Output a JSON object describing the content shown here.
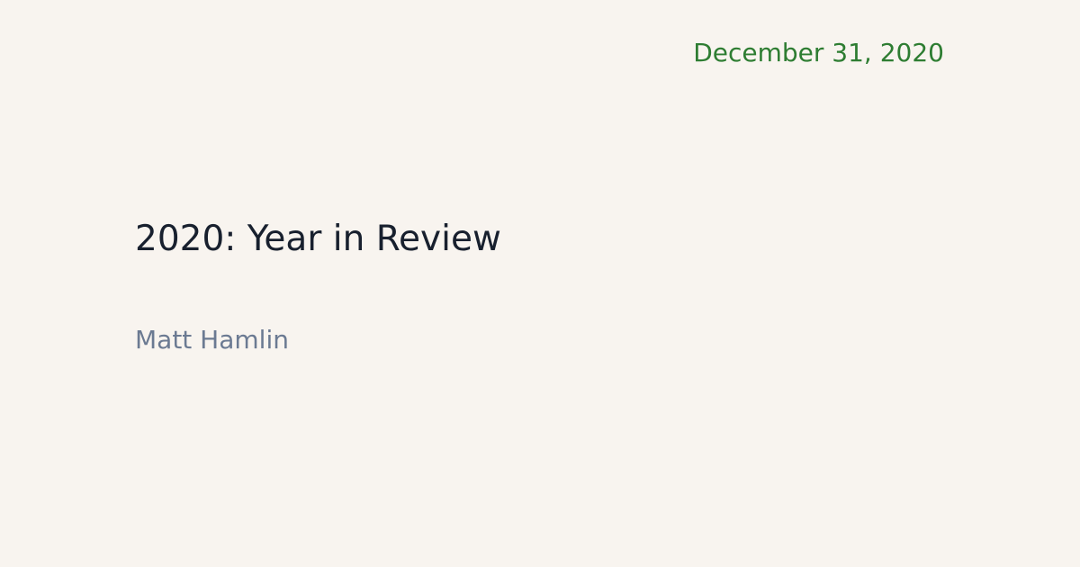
{
  "post": {
    "date": "December 31, 2020",
    "title": "2020: Year in Review",
    "author": "Matt Hamlin"
  },
  "colors": {
    "background": "#f8f4ef",
    "date": "#2e7d32",
    "title": "#18202e",
    "author": "#6b7a92"
  }
}
